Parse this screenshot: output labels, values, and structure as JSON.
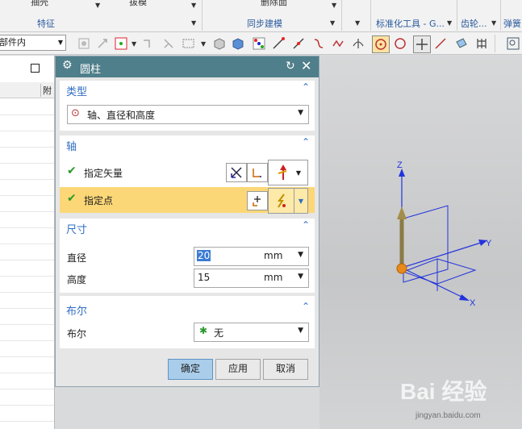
{
  "ribbon": {
    "top_labels": [
      "抽壳",
      "拔模",
      "删除面"
    ],
    "group_labels": [
      "特征",
      "同步建模",
      "标准化工具 - G...",
      "齿轮...",
      "弹簧"
    ]
  },
  "toolbar": {
    "filter_value": "部件内"
  },
  "nav": {
    "header_letter": "附"
  },
  "dialog": {
    "title": "圆柱",
    "type_section": {
      "title": "类型",
      "selected": "轴、直径和高度"
    },
    "axis_section": {
      "title": "轴",
      "vector_label": "指定矢量",
      "point_label": "指定点"
    },
    "size_section": {
      "title": "尺寸",
      "diameter_label": "直径",
      "diameter_value": "20",
      "diameter_unit": "mm",
      "height_label": "高度",
      "height_value": "15",
      "height_unit": "mm"
    },
    "bool_section": {
      "title": "布尔",
      "label": "布尔",
      "value": "无"
    },
    "buttons": {
      "ok": "确定",
      "apply": "应用",
      "cancel": "取消"
    }
  },
  "viewport": {
    "axis_x": "X",
    "axis_y": "Y",
    "axis_z": "Z"
  },
  "watermark": {
    "text": "Bai 经验",
    "url": "jingyan.baidu.com"
  },
  "colors": {
    "title_bar": "#4f7f8b",
    "section_text": "#2f6ec4",
    "highlight_row": "#fcd777",
    "ok_button": "#a9cdea"
  }
}
